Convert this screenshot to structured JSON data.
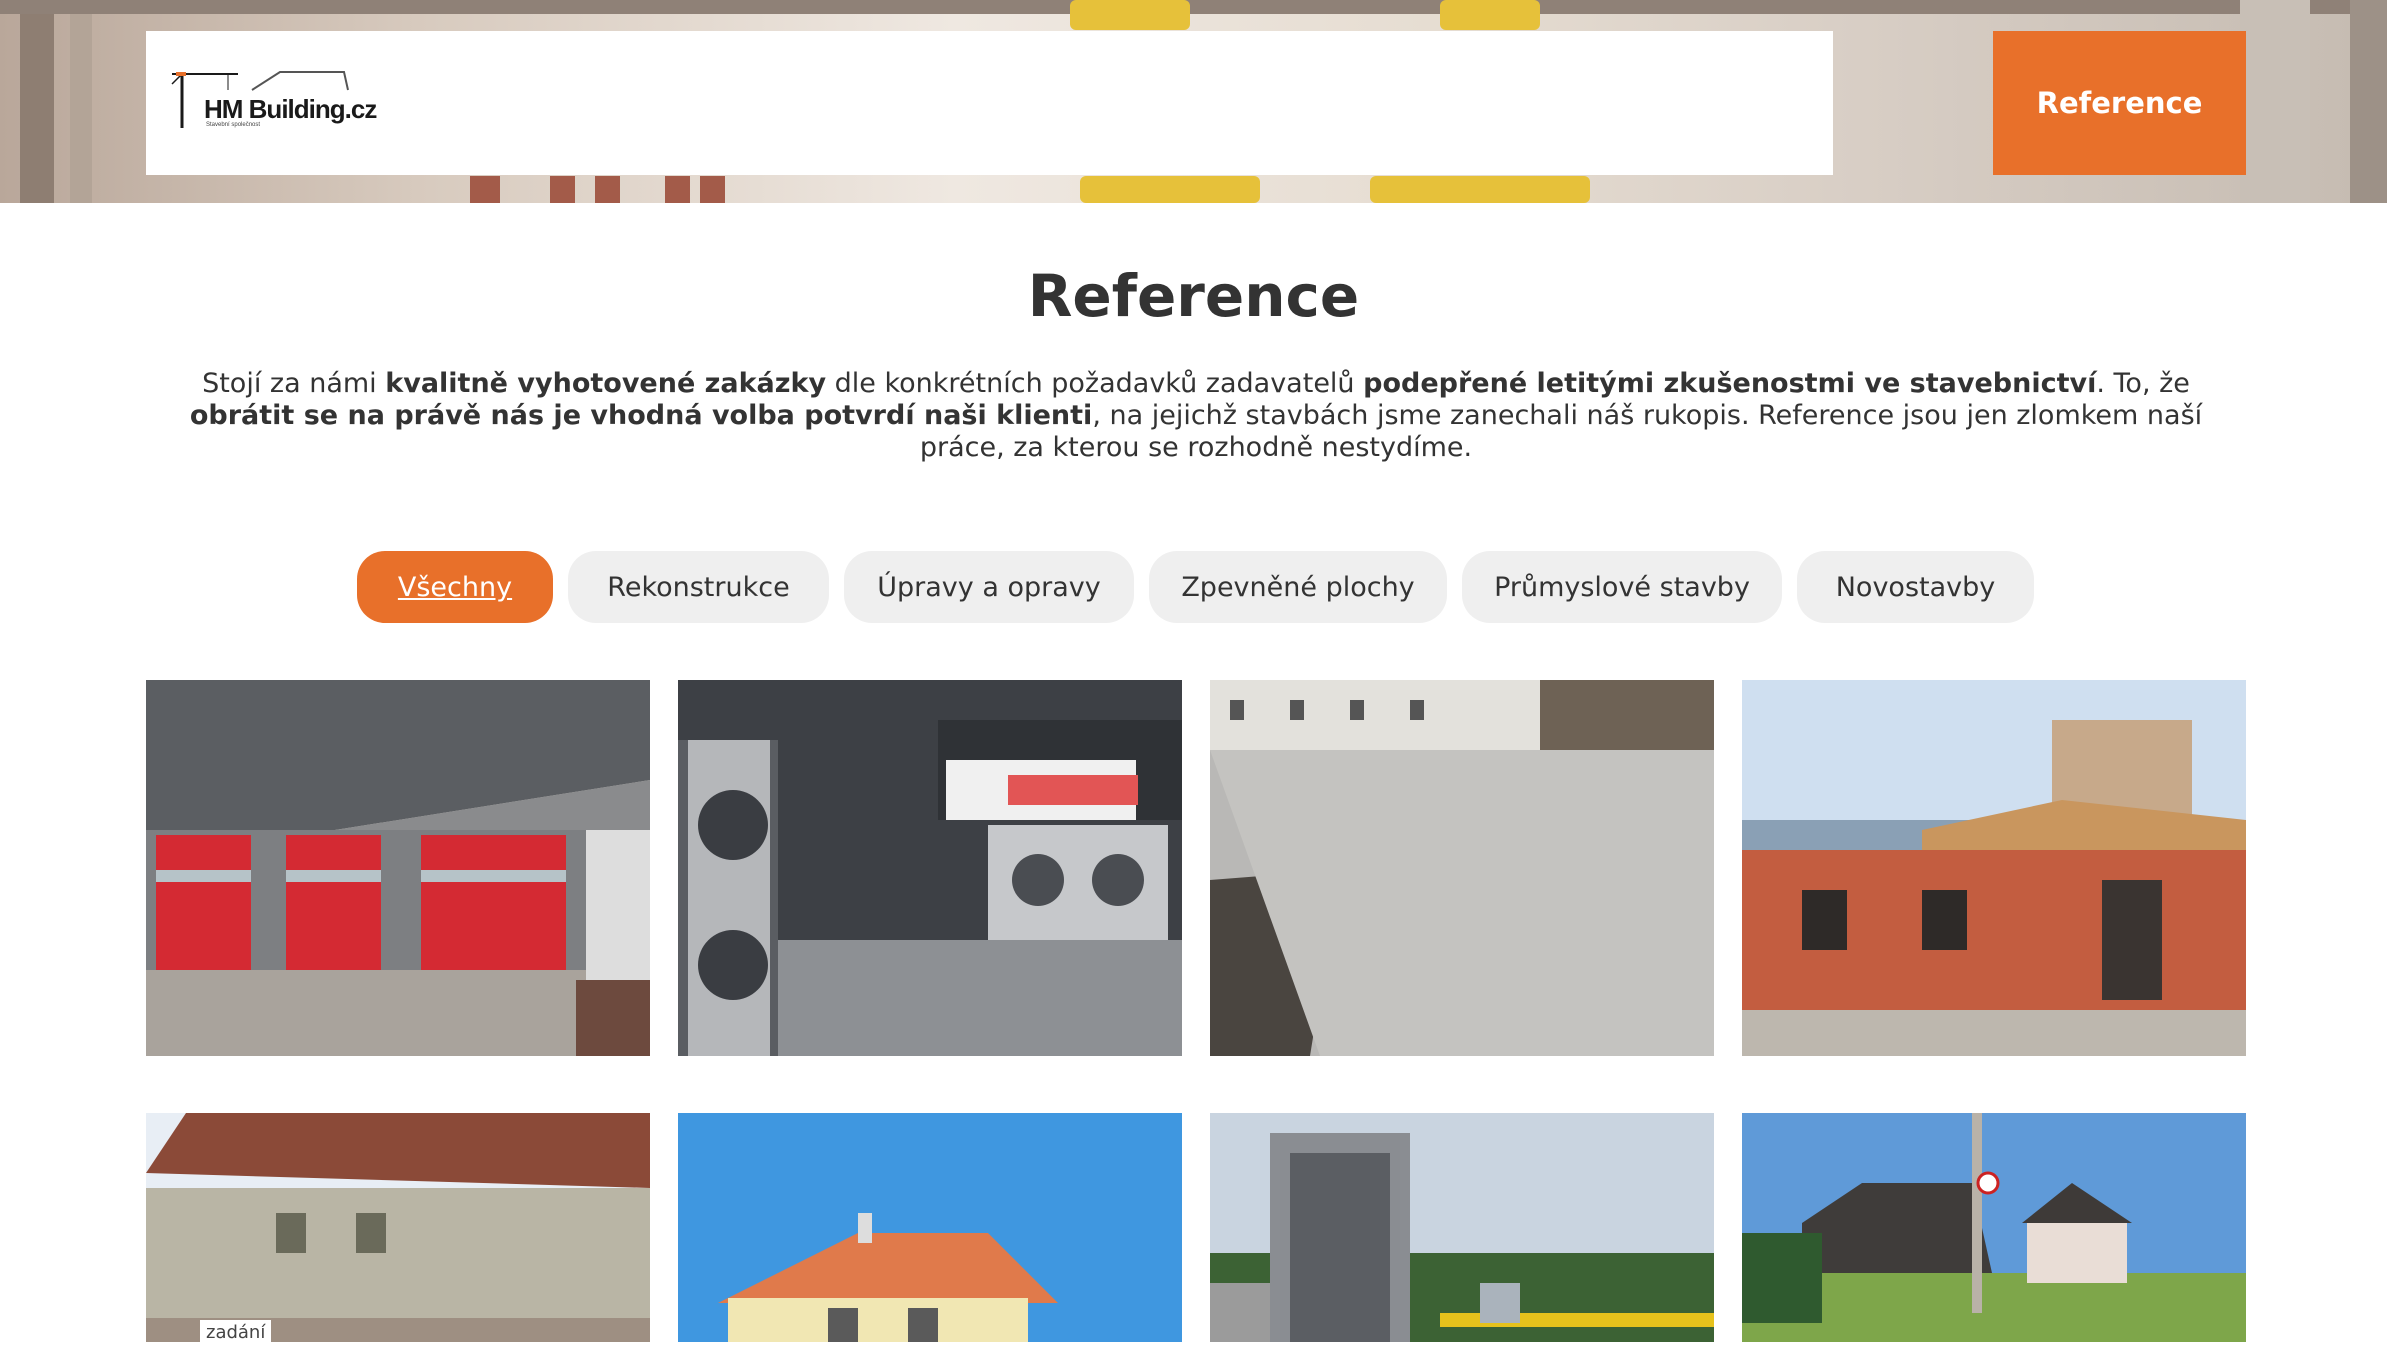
{
  "header": {
    "logo": {
      "name": "HM Building.cz",
      "tagline": "Stavební společnost"
    },
    "nav_button_label": "Reference"
  },
  "page": {
    "title": "Reference",
    "intro": {
      "p1": "Stojí za námi ",
      "b1": "kvalitně vyhotovené zakázky",
      "p2": " dle konkrétních požadavků zadavatelů ",
      "b2": "podepřené letitými zkušenostmi ve stavebnictví",
      "p3": ". To, že ",
      "b3": "obrátit se na právě nás je vhodná volba potvrdí naši klienti",
      "p4": ", na jejichž stavbách jsme zanechali náš rukopis. Reference jsou jen zlomkem naší práce, za kterou se rozhodně nestydíme."
    }
  },
  "filters": [
    {
      "label": "Všechny",
      "active": true
    },
    {
      "label": "Rekonstrukce",
      "active": false
    },
    {
      "label": "Úpravy a opravy",
      "active": false
    },
    {
      "label": "Zpevněné plochy",
      "active": false
    },
    {
      "label": "Průmyslové stavby",
      "active": false
    },
    {
      "label": "Novostavby",
      "active": false
    }
  ],
  "gallery": {
    "tile_caption": "zadání",
    "items": [
      {
        "subject": "fire-station-garage-red-doors"
      },
      {
        "subject": "laundry-room-washing-machines"
      },
      {
        "subject": "paved-parking-area"
      },
      {
        "subject": "brick-house-under-construction"
      },
      {
        "subject": "old-house-reconstruction"
      },
      {
        "subject": "house-orange-roof"
      },
      {
        "subject": "industrial-steel-structure"
      },
      {
        "subject": "rural-houses-street"
      }
    ]
  },
  "colors": {
    "accent": "#e8702a",
    "chip_bg": "#efefef",
    "text": "#333333"
  }
}
